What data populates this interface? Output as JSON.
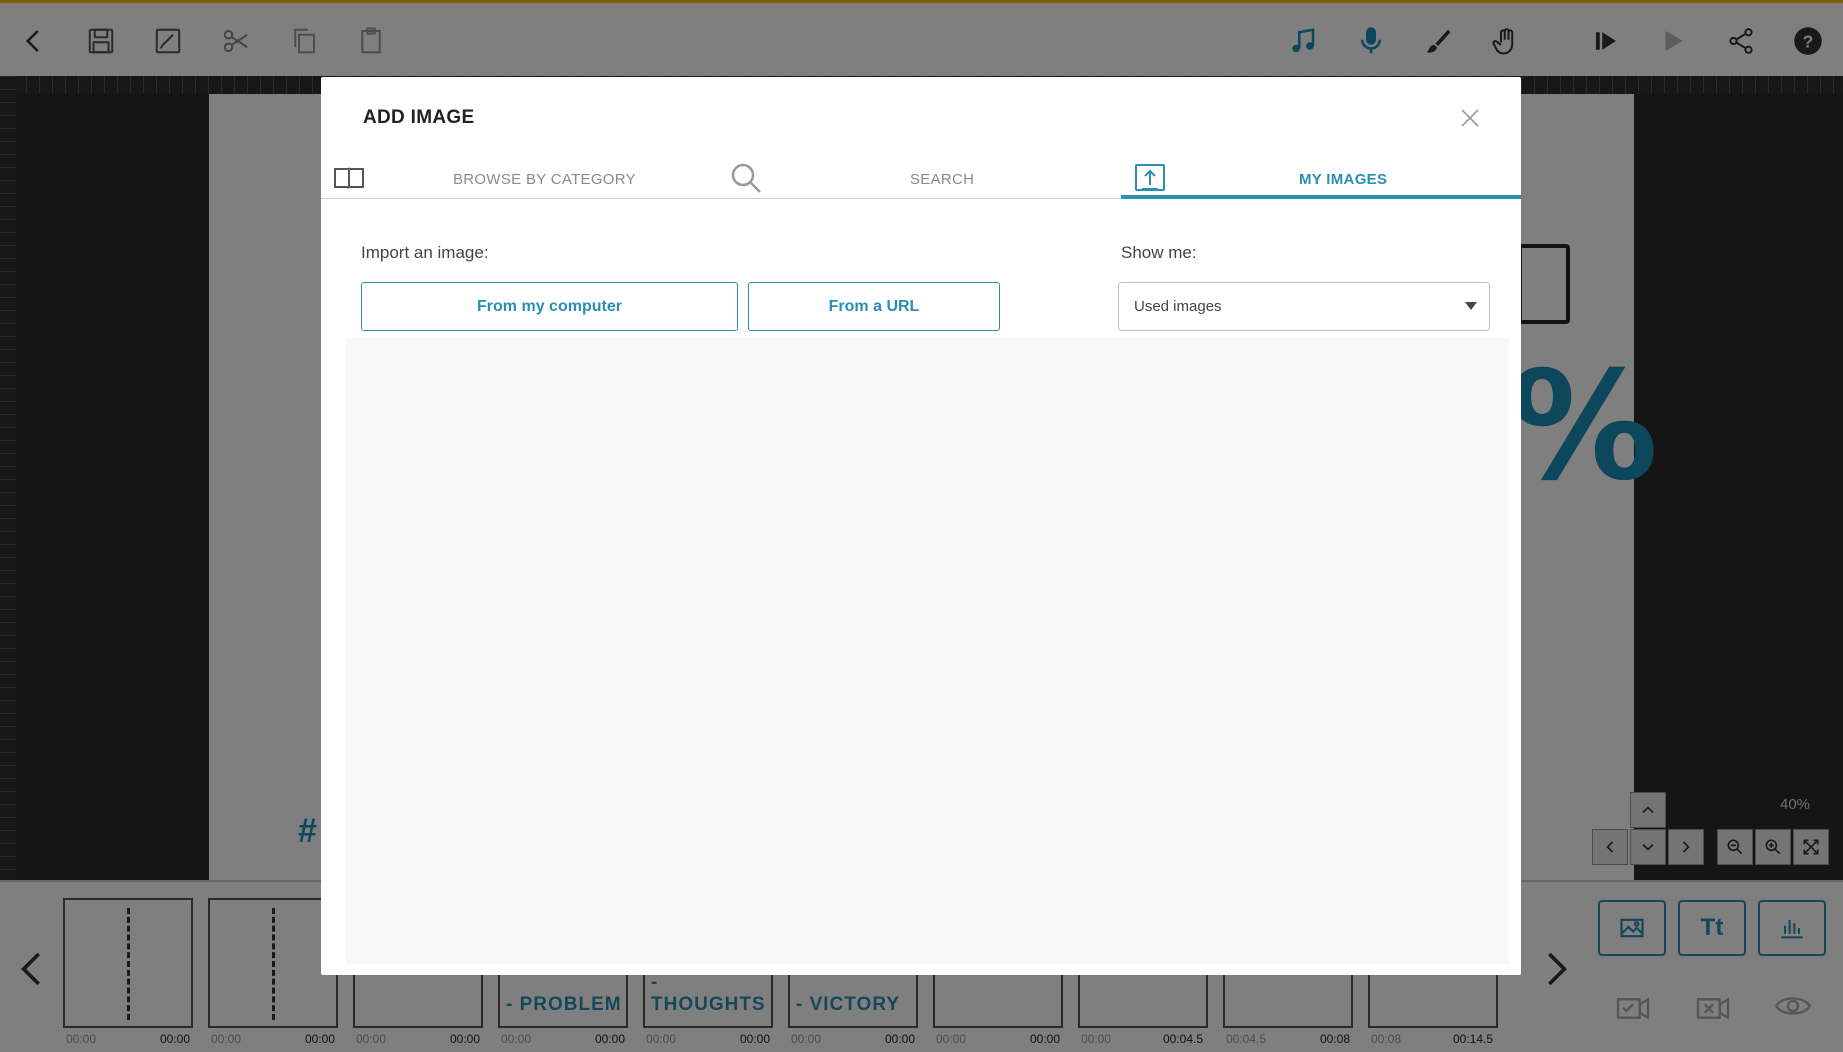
{
  "toolbar": {
    "left_icons": [
      "back-icon",
      "save-icon",
      "save-as-icon",
      "cut-icon",
      "copy-icon",
      "paste-icon"
    ],
    "right_icons": [
      "music-icon",
      "microphone-icon",
      "brush-icon",
      "hand-icon",
      "play-from-start-icon",
      "play-icon",
      "share-icon",
      "help-icon"
    ],
    "accent_color": "#1b8fb8"
  },
  "canvas": {
    "hash_text": "#",
    "percent_text": "%",
    "zoom_label": "40%"
  },
  "timeline": {
    "thumbs": [
      {
        "caption": "",
        "in": "00:00",
        "out": "00:00"
      },
      {
        "caption": "",
        "in": "00:00",
        "out": "00:00"
      },
      {
        "caption": "",
        "in": "00:00",
        "out": "00:00"
      },
      {
        "caption": "- PROBLEM",
        "in": "00:00",
        "out": "00:00"
      },
      {
        "caption": "- THOUGHTS",
        "in": "00:00",
        "out": "00:00"
      },
      {
        "caption": "- VICTORY",
        "in": "00:00",
        "out": "00:00"
      },
      {
        "caption": "",
        "in": "00:00",
        "out": "00:00"
      },
      {
        "caption": "",
        "in": "00:00",
        "out": "00:04.5"
      },
      {
        "caption": "",
        "in": "00:04.5",
        "out": "00:08"
      },
      {
        "caption": "",
        "in": "00:08",
        "out": "00:14.5"
      }
    ],
    "tool_text_label": "Tt"
  },
  "modal": {
    "title": "ADD IMAGE",
    "tabs": [
      {
        "label": "BROWSE BY CATEGORY",
        "icon": "book-icon"
      },
      {
        "label": "SEARCH",
        "icon": "search-icon"
      },
      {
        "label": "MY IMAGES",
        "icon": "upload-icon"
      }
    ],
    "active_tab": "MY IMAGES",
    "import_label": "Import an image:",
    "from_computer": "From my computer",
    "from_url": "From a URL",
    "show_me_label": "Show me:",
    "show_me_value": "Used images"
  }
}
